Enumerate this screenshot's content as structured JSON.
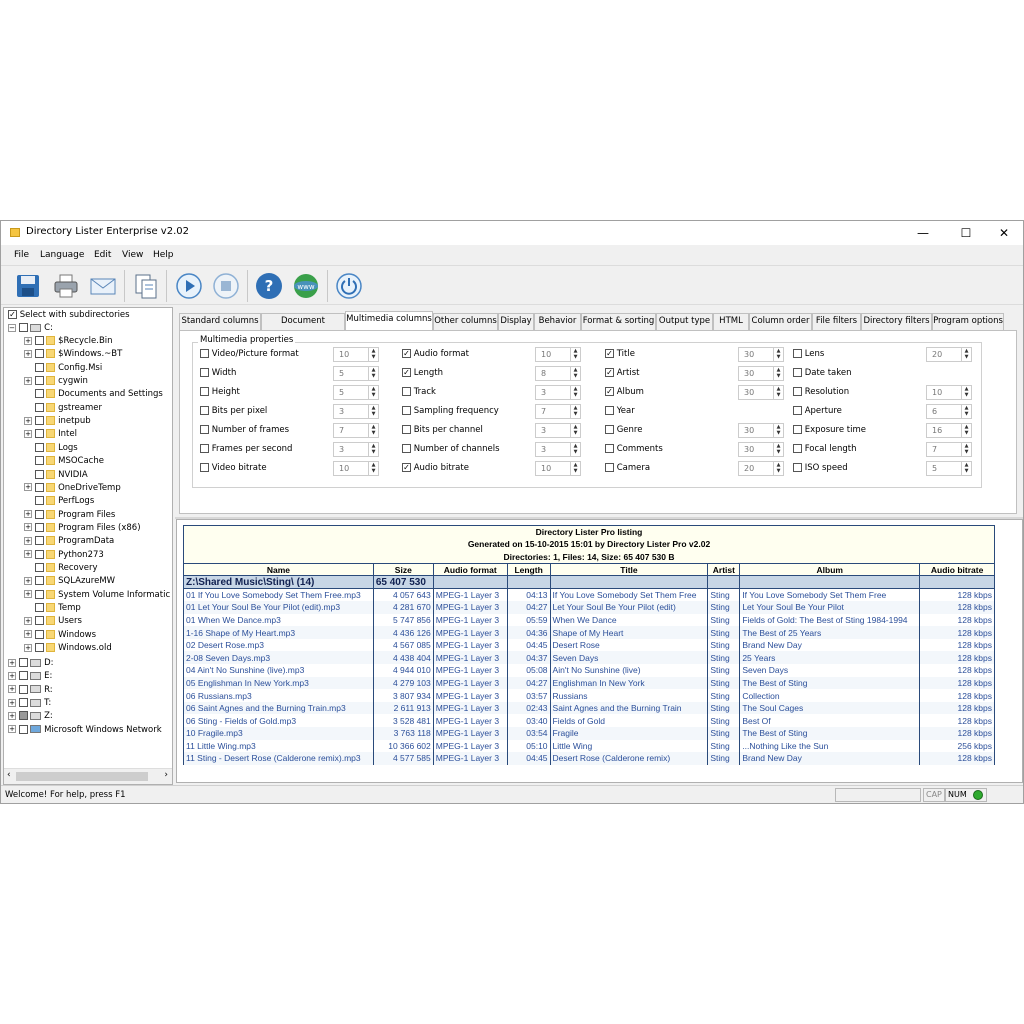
{
  "window": {
    "title": "Directory Lister Enterprise v2.02",
    "minimize": "—",
    "maximize": "☐",
    "close": "✕"
  },
  "menu": [
    "File",
    "Language",
    "Edit",
    "View",
    "Help"
  ],
  "toolbar": {
    "icons": [
      "save-icon",
      "print-icon",
      "email-icon",
      "document-icon",
      "play-icon",
      "stop-icon",
      "help-icon",
      "www-icon",
      "power-icon"
    ],
    "www_label": "www"
  },
  "sidebar": {
    "select_subdirs": "Select with subdirectories",
    "root": "C:",
    "folders": [
      "$Recycle.Bin",
      "$Windows.~BT",
      "Config.Msi",
      "cygwin",
      "Documents and Settings",
      "gstreamer",
      "inetpub",
      "Intel",
      "Logs",
      "MSOCache",
      "NVIDIA",
      "OneDriveTemp",
      "PerfLogs",
      "Program Files",
      "Program Files (x86)",
      "ProgramData",
      "Python273",
      "Recovery",
      "SQLAzureMW",
      "System Volume Informatic",
      "Temp",
      "Users",
      "Windows",
      "Windows.old"
    ],
    "drives": [
      "D:",
      "E:",
      "R:",
      "T:",
      "Z:"
    ],
    "network": "Microsoft Windows Network"
  },
  "tabs": [
    "Standard columns",
    "Document columns",
    "Multimedia columns",
    "Other columns",
    "Display",
    "Behavior",
    "Format & sorting",
    "Output type",
    "HTML",
    "Column order",
    "File filters",
    "Directory filters",
    "Program options"
  ],
  "active_tab": "Multimedia columns",
  "multimedia": {
    "group_title": "Multimedia properties",
    "columns": [
      [
        {
          "label": "Video/Picture format",
          "checked": false,
          "value": "10"
        },
        {
          "label": "Width",
          "checked": false,
          "value": "5"
        },
        {
          "label": "Height",
          "checked": false,
          "value": "5"
        },
        {
          "label": "Bits per pixel",
          "checked": false,
          "value": "3"
        },
        {
          "label": "Number of frames",
          "checked": false,
          "value": "7"
        },
        {
          "label": "Frames per second",
          "checked": false,
          "value": "3"
        },
        {
          "label": "Video bitrate",
          "checked": false,
          "value": "10"
        }
      ],
      [
        {
          "label": "Audio format",
          "checked": true,
          "value": "10"
        },
        {
          "label": "Length",
          "checked": true,
          "value": "8"
        },
        {
          "label": "Track",
          "checked": false,
          "value": "3"
        },
        {
          "label": "Sampling frequency",
          "checked": false,
          "value": "7"
        },
        {
          "label": "Bits per channel",
          "checked": false,
          "value": "3"
        },
        {
          "label": "Number of channels",
          "checked": false,
          "value": "3"
        },
        {
          "label": "Audio bitrate",
          "checked": true,
          "value": "10"
        }
      ],
      [
        {
          "label": "Title",
          "checked": true,
          "value": "30"
        },
        {
          "label": "Artist",
          "checked": true,
          "value": "30"
        },
        {
          "label": "Album",
          "checked": true,
          "value": "30"
        },
        {
          "label": "Year",
          "checked": false,
          "value": ""
        },
        {
          "label": "Genre",
          "checked": false,
          "value": "30"
        },
        {
          "label": "Comments",
          "checked": false,
          "value": "30"
        },
        {
          "label": "Camera",
          "checked": false,
          "value": "20"
        }
      ],
      [
        {
          "label": "Lens",
          "checked": false,
          "value": "20"
        },
        {
          "label": "Date taken",
          "checked": false,
          "value": ""
        },
        {
          "label": "Resolution",
          "checked": false,
          "value": "10"
        },
        {
          "label": "Aperture",
          "checked": false,
          "value": "6"
        },
        {
          "label": "Exposure time",
          "checked": false,
          "value": "16"
        },
        {
          "label": "Focal length",
          "checked": false,
          "value": "7"
        },
        {
          "label": "ISO speed",
          "checked": false,
          "value": "5"
        }
      ]
    ]
  },
  "listing": {
    "title": "Directory Lister Pro listing",
    "generated": "Generated on 15-10-2015 15:01 by Directory Lister Pro v2.02",
    "summary": "Directories: 1, Files: 14, Size: 65 407 530 B",
    "columns": [
      "Name",
      "Size",
      "Audio format",
      "Length",
      "Title",
      "Artist",
      "Album",
      "Audio bitrate"
    ],
    "dir": {
      "name": "Z:\\Shared Music\\Sting\\ (14)",
      "size": "65 407 530"
    },
    "rows": [
      [
        "01 If You Love Somebody Set Them Free.mp3",
        "4 057 643",
        "MPEG-1 Layer 3",
        "04:13",
        "If You Love Somebody Set Them Free",
        "Sting",
        "If You Love Somebody Set Them Free",
        "128 kbps"
      ],
      [
        "01 Let Your Soul Be Your Pilot (edit).mp3",
        "4 281 670",
        "MPEG-1 Layer 3",
        "04:27",
        "Let Your Soul Be Your Pilot (edit)",
        "Sting",
        "Let Your Soul Be Your Pilot",
        "128 kbps"
      ],
      [
        "01 When We Dance.mp3",
        "5 747 856",
        "MPEG-1 Layer 3",
        "05:59",
        "When We Dance",
        "Sting",
        "Fields of Gold: The Best of Sting 1984-1994",
        "128 kbps"
      ],
      [
        "1-16 Shape of My Heart.mp3",
        "4 436 126",
        "MPEG-1 Layer 3",
        "04:36",
        "Shape of My Heart",
        "Sting",
        "The Best of 25 Years",
        "128 kbps"
      ],
      [
        "02 Desert Rose.mp3",
        "4 567 085",
        "MPEG-1 Layer 3",
        "04:45",
        "Desert Rose",
        "Sting",
        "Brand New Day",
        "128 kbps"
      ],
      [
        "2-08 Seven Days.mp3",
        "4 438 404",
        "MPEG-1 Layer 3",
        "04:37",
        "Seven Days",
        "Sting",
        "25 Years",
        "128 kbps"
      ],
      [
        "04 Ain't No Sunshine (live).mp3",
        "4 944 010",
        "MPEG-1 Layer 3",
        "05:08",
        "Ain't No Sunshine (live)",
        "Sting",
        "Seven Days",
        "128 kbps"
      ],
      [
        "05 Englishman In New York.mp3",
        "4 279 103",
        "MPEG-1 Layer 3",
        "04:27",
        "Englishman In New York",
        "Sting",
        "The Best of Sting",
        "128 kbps"
      ],
      [
        "06 Russians.mp3",
        "3 807 934",
        "MPEG-1 Layer 3",
        "03:57",
        "Russians",
        "Sting",
        "Collection",
        "128 kbps"
      ],
      [
        "06 Saint Agnes and the Burning Train.mp3",
        "2 611 913",
        "MPEG-1 Layer 3",
        "02:43",
        "Saint Agnes and the Burning Train",
        "Sting",
        "The Soul Cages",
        "128 kbps"
      ],
      [
        "06 Sting - Fields of Gold.mp3",
        "3 528 481",
        "MPEG-1 Layer 3",
        "03:40",
        "Fields of Gold",
        "Sting",
        "Best Of",
        "128 kbps"
      ],
      [
        "10 Fragile.mp3",
        "3 763 118",
        "MPEG-1 Layer 3",
        "03:54",
        "Fragile",
        "Sting",
        "The Best of Sting",
        "128 kbps"
      ],
      [
        "11 Little Wing.mp3",
        "10 366 602",
        "MPEG-1 Layer 3",
        "05:10",
        "Little Wing",
        "Sting",
        "...Nothing Like the Sun",
        "256 kbps"
      ],
      [
        "11 Sting - Desert Rose (Calderone remix).mp3",
        "4 577 585",
        "MPEG-1 Layer 3",
        "04:45",
        "Desert Rose (Calderone remix)",
        "Sting",
        "Brand New Day",
        "128 kbps"
      ]
    ]
  },
  "status": {
    "text": "Welcome! For help, press F1",
    "cap": "CAP",
    "num": "NUM"
  }
}
